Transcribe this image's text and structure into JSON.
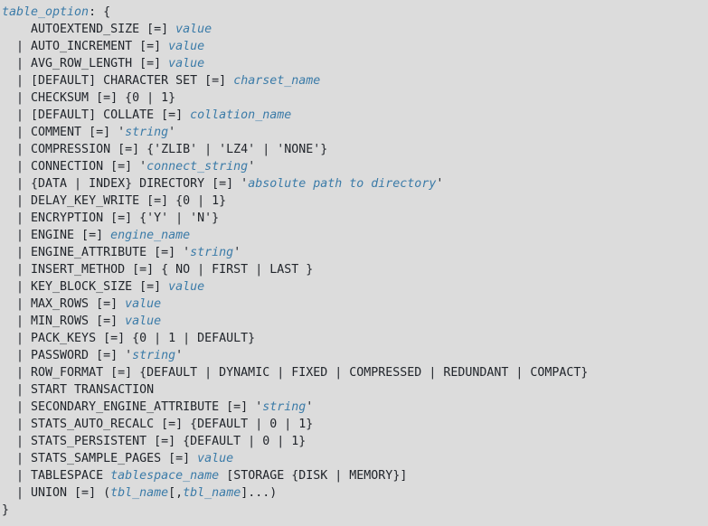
{
  "document": {
    "kind": "sql-syntax-listing",
    "title": "table_option syntax",
    "background_color": "#dcdcdc",
    "keyword_color": "#21252b",
    "placeholder_color": "#3b7ba8",
    "font_size_px": 13.3,
    "line_height_px": 19
  },
  "lines": [
    {
      "id": "line-1",
      "indent": 0,
      "text": "table_option: {",
      "tokens": [
        {
          "t": "table_option",
          "s": "ph"
        },
        {
          "t": ": {",
          "s": "kw"
        }
      ]
    },
    {
      "id": "line-2",
      "indent": 4,
      "text": "    AUTOEXTEND_SIZE [=] value",
      "tokens": [
        {
          "t": "    AUTOEXTEND_SIZE [=] ",
          "s": "kw"
        },
        {
          "t": "value",
          "s": "ph"
        }
      ]
    },
    {
      "id": "line-3",
      "indent": 2,
      "text": "  | AUTO_INCREMENT [=] value",
      "tokens": [
        {
          "t": "  | AUTO_INCREMENT [=] ",
          "s": "kw"
        },
        {
          "t": "value",
          "s": "ph"
        }
      ]
    },
    {
      "id": "line-4",
      "indent": 2,
      "text": "  | AVG_ROW_LENGTH [=] value",
      "tokens": [
        {
          "t": "  | AVG_ROW_LENGTH [=] ",
          "s": "kw"
        },
        {
          "t": "value",
          "s": "ph"
        }
      ]
    },
    {
      "id": "line-5",
      "indent": 2,
      "text": "  | [DEFAULT] CHARACTER SET [=] charset_name",
      "tokens": [
        {
          "t": "  | [DEFAULT] CHARACTER SET [=] ",
          "s": "kw"
        },
        {
          "t": "charset_name",
          "s": "ph"
        }
      ]
    },
    {
      "id": "line-6",
      "indent": 2,
      "text": "  | CHECKSUM [=] {0 | 1}",
      "tokens": [
        {
          "t": "  | CHECKSUM [=] {0 | 1}",
          "s": "kw"
        }
      ]
    },
    {
      "id": "line-7",
      "indent": 2,
      "text": "  | [DEFAULT] COLLATE [=] collation_name",
      "tokens": [
        {
          "t": "  | [DEFAULT] COLLATE [=] ",
          "s": "kw"
        },
        {
          "t": "collation_name",
          "s": "ph"
        }
      ]
    },
    {
      "id": "line-8",
      "indent": 2,
      "text": "  | COMMENT [=] 'string'",
      "tokens": [
        {
          "t": "  | COMMENT [=] '",
          "s": "kw"
        },
        {
          "t": "string",
          "s": "ph"
        },
        {
          "t": "'",
          "s": "kw"
        }
      ]
    },
    {
      "id": "line-9",
      "indent": 2,
      "text": "  | COMPRESSION [=] {'ZLIB' | 'LZ4' | 'NONE'}",
      "tokens": [
        {
          "t": "  | COMPRESSION [=] {'ZLIB' | 'LZ4' | 'NONE'}",
          "s": "kw"
        }
      ]
    },
    {
      "id": "line-10",
      "indent": 2,
      "text": "  | CONNECTION [=] 'connect_string'",
      "tokens": [
        {
          "t": "  | CONNECTION [=] '",
          "s": "kw"
        },
        {
          "t": "connect_string",
          "s": "ph"
        },
        {
          "t": "'",
          "s": "kw"
        }
      ]
    },
    {
      "id": "line-11",
      "indent": 2,
      "text": "  | {DATA | INDEX} DIRECTORY [=] 'absolute path to directory'",
      "tokens": [
        {
          "t": "  | {DATA | INDEX} DIRECTORY [=] '",
          "s": "kw"
        },
        {
          "t": "absolute path to directory",
          "s": "ph"
        },
        {
          "t": "'",
          "s": "kw"
        }
      ]
    },
    {
      "id": "line-12",
      "indent": 2,
      "text": "  | DELAY_KEY_WRITE [=] {0 | 1}",
      "tokens": [
        {
          "t": "  | DELAY_KEY_WRITE [=] {0 | 1}",
          "s": "kw"
        }
      ]
    },
    {
      "id": "line-13",
      "indent": 2,
      "text": "  | ENCRYPTION [=] {'Y' | 'N'}",
      "tokens": [
        {
          "t": "  | ENCRYPTION [=] {'Y' | 'N'}",
          "s": "kw"
        }
      ]
    },
    {
      "id": "line-14",
      "indent": 2,
      "text": "  | ENGINE [=] engine_name",
      "tokens": [
        {
          "t": "  | ENGINE [=] ",
          "s": "kw"
        },
        {
          "t": "engine_name",
          "s": "ph"
        }
      ]
    },
    {
      "id": "line-15",
      "indent": 2,
      "text": "  | ENGINE_ATTRIBUTE [=] 'string'",
      "tokens": [
        {
          "t": "  | ENGINE_ATTRIBUTE [=] '",
          "s": "kw"
        },
        {
          "t": "string",
          "s": "ph"
        },
        {
          "t": "'",
          "s": "kw"
        }
      ]
    },
    {
      "id": "line-16",
      "indent": 2,
      "text": "  | INSERT_METHOD [=] { NO | FIRST | LAST }",
      "tokens": [
        {
          "t": "  | INSERT_METHOD [=] { NO | FIRST | LAST }",
          "s": "kw"
        }
      ]
    },
    {
      "id": "line-17",
      "indent": 2,
      "text": "  | KEY_BLOCK_SIZE [=] value",
      "tokens": [
        {
          "t": "  | KEY_BLOCK_SIZE [=] ",
          "s": "kw"
        },
        {
          "t": "value",
          "s": "ph"
        }
      ]
    },
    {
      "id": "line-18",
      "indent": 2,
      "text": "  | MAX_ROWS [=] value",
      "tokens": [
        {
          "t": "  | MAX_ROWS [=] ",
          "s": "kw"
        },
        {
          "t": "value",
          "s": "ph"
        }
      ]
    },
    {
      "id": "line-19",
      "indent": 2,
      "text": "  | MIN_ROWS [=] value",
      "tokens": [
        {
          "t": "  | MIN_ROWS [=] ",
          "s": "kw"
        },
        {
          "t": "value",
          "s": "ph"
        }
      ]
    },
    {
      "id": "line-20",
      "indent": 2,
      "text": "  | PACK_KEYS [=] {0 | 1 | DEFAULT}",
      "tokens": [
        {
          "t": "  | PACK_KEYS [=] {0 | 1 | DEFAULT}",
          "s": "kw"
        }
      ]
    },
    {
      "id": "line-21",
      "indent": 2,
      "text": "  | PASSWORD [=] 'string'",
      "tokens": [
        {
          "t": "  | PASSWORD [=] '",
          "s": "kw"
        },
        {
          "t": "string",
          "s": "ph"
        },
        {
          "t": "'",
          "s": "kw"
        }
      ]
    },
    {
      "id": "line-22",
      "indent": 2,
      "text": "  | ROW_FORMAT [=] {DEFAULT | DYNAMIC | FIXED | COMPRESSED | REDUNDANT | COMPACT}",
      "tokens": [
        {
          "t": "  | ROW_FORMAT [=] {DEFAULT | DYNAMIC | FIXED | COMPRESSED | REDUNDANT | COMPACT}",
          "s": "kw"
        }
      ]
    },
    {
      "id": "line-23",
      "indent": 2,
      "text": "  | START TRANSACTION",
      "tokens": [
        {
          "t": "  | START TRANSACTION",
          "s": "kw"
        }
      ]
    },
    {
      "id": "line-24",
      "indent": 2,
      "text": "  | SECONDARY_ENGINE_ATTRIBUTE [=] 'string'",
      "tokens": [
        {
          "t": "  | SECONDARY_ENGINE_ATTRIBUTE [=] '",
          "s": "kw"
        },
        {
          "t": "string",
          "s": "ph"
        },
        {
          "t": "'",
          "s": "kw"
        }
      ]
    },
    {
      "id": "line-25",
      "indent": 2,
      "text": "  | STATS_AUTO_RECALC [=] {DEFAULT | 0 | 1}",
      "tokens": [
        {
          "t": "  | STATS_AUTO_RECALC [=] {DEFAULT | 0 | 1}",
          "s": "kw"
        }
      ]
    },
    {
      "id": "line-26",
      "indent": 2,
      "text": "  | STATS_PERSISTENT [=] {DEFAULT | 0 | 1}",
      "tokens": [
        {
          "t": "  | STATS_PERSISTENT [=] {DEFAULT | 0 | 1}",
          "s": "kw"
        }
      ]
    },
    {
      "id": "line-27",
      "indent": 2,
      "text": "  | STATS_SAMPLE_PAGES [=] value",
      "tokens": [
        {
          "t": "  | STATS_SAMPLE_PAGES [=] ",
          "s": "kw"
        },
        {
          "t": "value",
          "s": "ph"
        }
      ]
    },
    {
      "id": "line-28",
      "indent": 2,
      "text": "  | TABLESPACE tablespace_name [STORAGE {DISK | MEMORY}]",
      "tokens": [
        {
          "t": "  | TABLESPACE ",
          "s": "kw"
        },
        {
          "t": "tablespace_name",
          "s": "ph"
        },
        {
          "t": " [STORAGE {DISK | MEMORY}]",
          "s": "kw"
        }
      ]
    },
    {
      "id": "line-29",
      "indent": 2,
      "text": "  | UNION [=] (tbl_name[,tbl_name]...)",
      "tokens": [
        {
          "t": "  | UNION [=] (",
          "s": "kw"
        },
        {
          "t": "tbl_name",
          "s": "ph"
        },
        {
          "t": "[,",
          "s": "kw"
        },
        {
          "t": "tbl_name",
          "s": "ph"
        },
        {
          "t": "]...)",
          "s": "kw"
        }
      ]
    },
    {
      "id": "line-30",
      "indent": 0,
      "text": "}",
      "tokens": [
        {
          "t": "}",
          "s": "kw"
        }
      ]
    }
  ]
}
